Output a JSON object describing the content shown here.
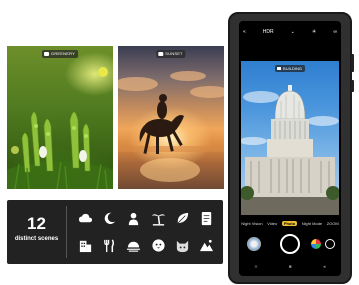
{
  "photos": {
    "greenery_tag": "GREENERY",
    "sunset_tag": "SUNSET"
  },
  "scenes": {
    "count": "12",
    "caption": "distinct scenes",
    "icons": [
      "cloud-icon",
      "moon-icon",
      "baby-icon",
      "palm-tree-icon",
      "leaf-icon",
      "document-icon",
      "building-icon",
      "utensils-icon",
      "sunset-icon",
      "pet-icon",
      "cat-icon",
      "mountain-icon"
    ]
  },
  "phone": {
    "top_icons": [
      "«",
      "HDR",
      "⌄",
      "☀",
      "∞"
    ],
    "mode_tag": "BUILDING",
    "modes": [
      "Night Vision",
      "Video",
      "Photo",
      "Night Mode",
      "ZOOM"
    ],
    "active_mode": "Photo",
    "nav_icons": [
      "≡",
      "■",
      "◂"
    ]
  },
  "colors": {
    "scene_bar": "#222222",
    "phone_body": "#303030",
    "active_mode": "#f0c030",
    "cat_icon": "#dddddd"
  }
}
